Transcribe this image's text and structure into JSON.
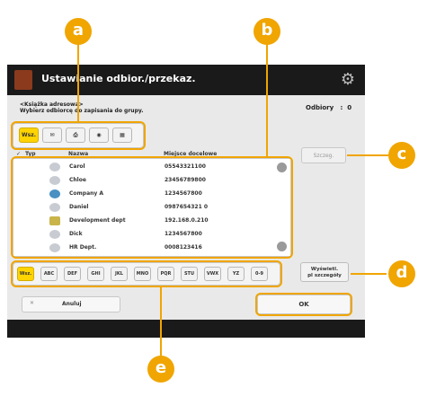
{
  "window": {
    "title": "Ustawianie odbior./przekaz."
  },
  "header": {
    "breadcrumb": "<Książka adresowa>",
    "instruction": "Wybierz odbiorcę do zapisania do grupy.",
    "recipients_label": "Odbiory",
    "recipients_count": "0"
  },
  "filter_tabs": [
    {
      "label": "Wsz.",
      "active": true,
      "icon": ""
    },
    {
      "label": "",
      "active": false,
      "icon": "mail-icon"
    },
    {
      "label": "",
      "active": false,
      "icon": "fax-icon"
    },
    {
      "label": "",
      "active": false,
      "icon": "globe-icon"
    },
    {
      "label": "",
      "active": false,
      "icon": "group-icon"
    }
  ],
  "list": {
    "col_type": "Typ",
    "col_name": "Nazwa",
    "col_address": "Miejsce docelowe",
    "rows": [
      {
        "name": "Carol",
        "address": "05543321100",
        "icon": "fax-icon"
      },
      {
        "name": "Chloe",
        "address": "23456789800",
        "icon": "fax-icon"
      },
      {
        "name": "Company A",
        "address": "1234567800",
        "icon": "globe-icon"
      },
      {
        "name": "Daniel",
        "address": "0987654321 0",
        "icon": "fax-icon"
      },
      {
        "name": "Development dept",
        "address": "192.168.0.210",
        "icon": "group-icon"
      },
      {
        "name": "Dick",
        "address": "1234567800",
        "icon": "fax-icon"
      },
      {
        "name": "HR Dept.",
        "address": "0008123416",
        "icon": "fax-icon"
      }
    ]
  },
  "buttons": {
    "details": "Szczeg.",
    "show_all_line1": "Wyświetl.",
    "show_all_line2": "pl szczegóły",
    "cancel": "Anuluj",
    "ok": "OK"
  },
  "letter_tabs": [
    {
      "label": "Wsz.",
      "active": true
    },
    {
      "label": "ABC",
      "active": false
    },
    {
      "label": "DEF",
      "active": false
    },
    {
      "label": "GHI",
      "active": false
    },
    {
      "label": "JKL",
      "active": false
    },
    {
      "label": "MNO",
      "active": false
    },
    {
      "label": "PQR",
      "active": false
    },
    {
      "label": "STU",
      "active": false
    },
    {
      "label": "VWX",
      "active": false
    },
    {
      "label": "YZ",
      "active": false
    },
    {
      "label": "0-9",
      "active": false
    }
  ],
  "callouts": [
    "a",
    "b",
    "c",
    "d",
    "e"
  ],
  "colors": {
    "accent": "#f0a500",
    "tab_active": "#ffd400",
    "titlebar": "#1a1a1a"
  }
}
